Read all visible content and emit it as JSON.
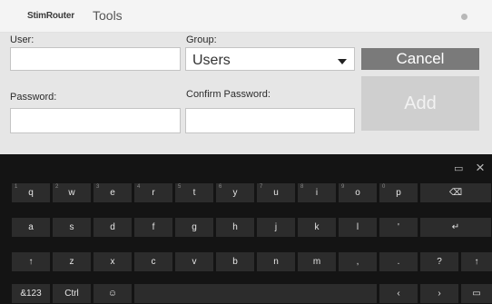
{
  "titlebar": {
    "logo": "StimRouter",
    "title": "Tools"
  },
  "form": {
    "user_label": "User:",
    "user_value": "",
    "group_label": "Group:",
    "group_value": "Users",
    "password_label": "Password:",
    "password_value": "",
    "confirm_label": "Confirm Password:",
    "confirm_value": "",
    "cancel_label": "Cancel",
    "add_label": "Add"
  },
  "keyboard": {
    "row1": [
      {
        "label": "q",
        "sub": "1"
      },
      {
        "label": "w",
        "sub": "2"
      },
      {
        "label": "e",
        "sub": "3"
      },
      {
        "label": "r",
        "sub": "4"
      },
      {
        "label": "t",
        "sub": "5"
      },
      {
        "label": "y",
        "sub": "6"
      },
      {
        "label": "u",
        "sub": "7"
      },
      {
        "label": "i",
        "sub": "8"
      },
      {
        "label": "o",
        "sub": "9"
      },
      {
        "label": "p",
        "sub": "0"
      },
      {
        "label": "⌫",
        "sub": ""
      }
    ],
    "row2": [
      {
        "label": "a"
      },
      {
        "label": "s"
      },
      {
        "label": "d"
      },
      {
        "label": "f"
      },
      {
        "label": "g"
      },
      {
        "label": "h"
      },
      {
        "label": "j"
      },
      {
        "label": "k"
      },
      {
        "label": "l"
      },
      {
        "label": "'"
      },
      {
        "label": "↵"
      }
    ],
    "row3": [
      {
        "label": "↑"
      },
      {
        "label": "z"
      },
      {
        "label": "x"
      },
      {
        "label": "c"
      },
      {
        "label": "v"
      },
      {
        "label": "b"
      },
      {
        "label": "n"
      },
      {
        "label": "m"
      },
      {
        "label": ","
      },
      {
        "label": "."
      },
      {
        "label": "?"
      },
      {
        "label": "↑"
      }
    ],
    "row4": [
      {
        "label": "&123"
      },
      {
        "label": "Ctrl"
      },
      {
        "label": "☺"
      },
      {
        "label": ""
      },
      {
        "label": "‹"
      },
      {
        "label": "›"
      },
      {
        "label": "▭"
      }
    ],
    "close_icon": "×",
    "layout_icon": "▭"
  }
}
